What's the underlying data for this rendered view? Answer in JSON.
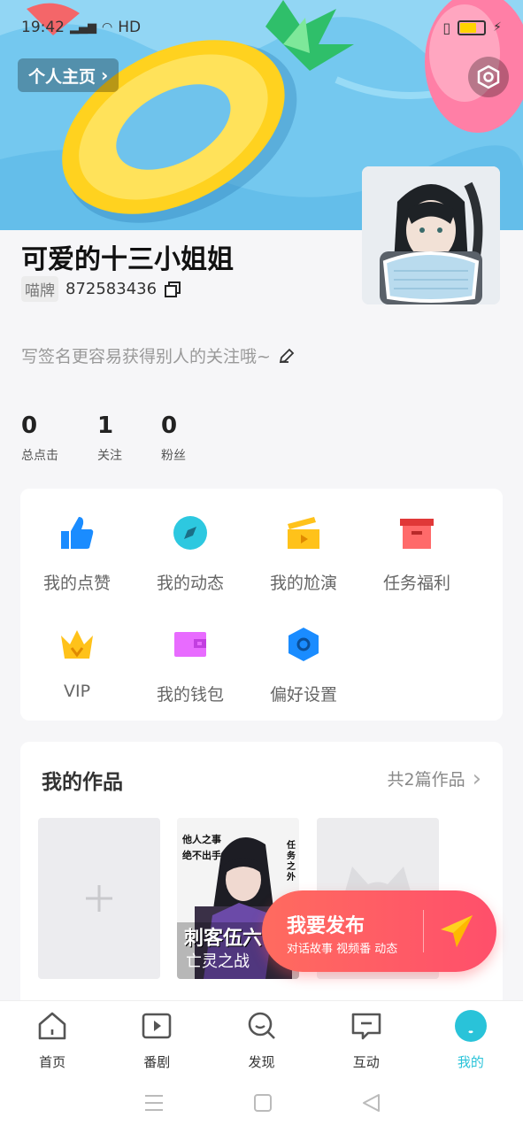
{
  "status_bar": {
    "time": "19:42",
    "network": "HD"
  },
  "header": {
    "homepage_label": "个人主页"
  },
  "profile": {
    "username": "可爱的十三小姐姐",
    "id_tag": "喵牌",
    "id_number": "872583436",
    "signature": "写签名更容易获得别人的关注哦~",
    "stats": [
      {
        "value": "0",
        "label": "总点击"
      },
      {
        "value": "1",
        "label": "关注"
      },
      {
        "value": "0",
        "label": "粉丝"
      }
    ]
  },
  "menu": {
    "items": [
      {
        "label": "我的点赞",
        "icon": "thumbs-up-icon",
        "color": "#1a8cff"
      },
      {
        "label": "我的动态",
        "icon": "compass-icon",
        "color": "#2dc8e0"
      },
      {
        "label": "我的尬演",
        "icon": "clapperboard-icon",
        "color": "#ffc21a"
      },
      {
        "label": "任务福利",
        "icon": "gift-box-icon",
        "color": "#ff5a5a"
      },
      {
        "label": "VIP",
        "icon": "crown-icon",
        "color": "#ffc21a"
      },
      {
        "label": "我的钱包",
        "icon": "wallet-icon",
        "color": "#e86bff"
      },
      {
        "label": "偏好设置",
        "icon": "hexagon-settings-icon",
        "color": "#1a8cff"
      }
    ]
  },
  "works": {
    "title": "我的作品",
    "count_label": "共2篇作品",
    "items": [
      {
        "title": "刺客伍六七",
        "subtitle": "亡灵之战",
        "cover_top_left": "他人之事",
        "cover_top_left2": "绝不出手",
        "cover_top_right": "任务之外"
      },
      {
        "title": ""
      }
    ]
  },
  "publish": {
    "label": "我要发布",
    "sub": "对话故事  视频番  动态"
  },
  "tabbar": {
    "items": [
      {
        "label": "首页",
        "icon": "home-icon"
      },
      {
        "label": "番剧",
        "icon": "play-icon"
      },
      {
        "label": "发现",
        "icon": "discover-icon"
      },
      {
        "label": "互动",
        "icon": "chat-icon"
      },
      {
        "label": "我的",
        "icon": "profile-icon",
        "active": true
      }
    ]
  },
  "colors": {
    "accent": "#29c3d9",
    "publish": "#ff5a68"
  }
}
